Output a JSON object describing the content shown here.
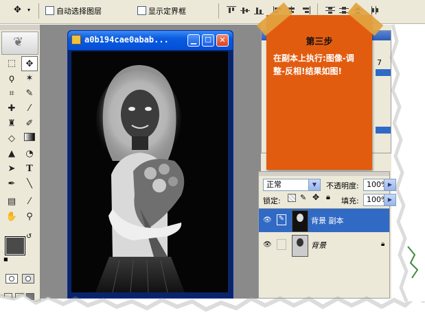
{
  "optionsbar": {
    "auto_select_label": "自动选择图层",
    "show_bounds_label": "显示定界框"
  },
  "document": {
    "title": "a0b194cae0abab..."
  },
  "note": {
    "title": "第三步",
    "line1": "在副本上执行:图像-调",
    "line2": "整-反相!结果如图!"
  },
  "layers_panel": {
    "blend_mode": "正常",
    "opacity_label": "不透明度:",
    "opacity_value": "100%",
    "lock_label": "锁定:",
    "fill_label": "填充:",
    "fill_value": "100%",
    "layers": [
      {
        "name": "背景 副本",
        "active": true
      },
      {
        "name": "背景",
        "active": false
      }
    ]
  },
  "partial_right": {
    "top_value": "7"
  },
  "colors": {
    "foreground": "#4a4a4a",
    "background": "#e25c10",
    "note": "#e25c10",
    "selection": "#316ac5"
  }
}
